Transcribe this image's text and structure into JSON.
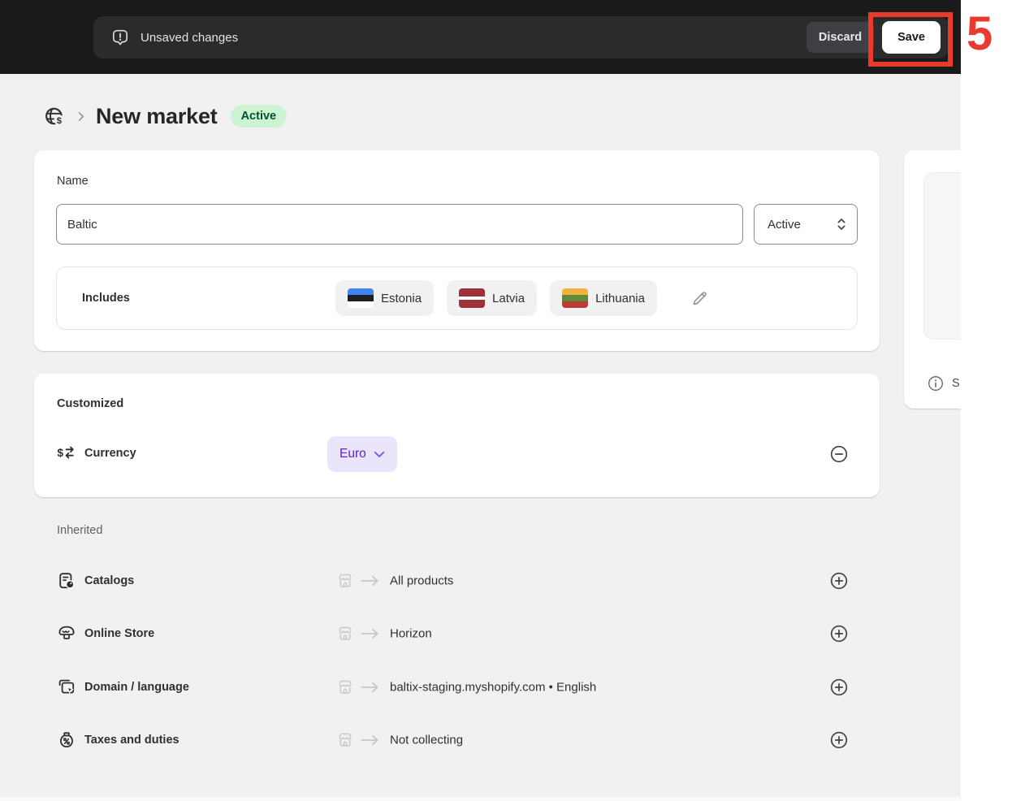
{
  "topbar": {
    "message": "Unsaved changes",
    "discard_label": "Discard",
    "save_label": "Save",
    "icons": {
      "status": "alert-bubble-icon"
    }
  },
  "annotation": {
    "number": "5",
    "color": "#e93a2d"
  },
  "header": {
    "title": "New market",
    "status_badge": "Active",
    "badge_bg": "#ccf4d2",
    "badge_text_color": "#07502f",
    "icons": {
      "breadcrumb": "markets-globe-dollar-icon",
      "separator": "chevron-right-icon"
    }
  },
  "market_card": {
    "name_label": "Name",
    "name_value": "Baltic",
    "status_value": "Active",
    "includes_label": "Includes",
    "countries": [
      {
        "name": "Estonia",
        "flag": {
          "stripes": [
            {
              "color": "#4285f4",
              "grow": "1"
            },
            {
              "color": "#1f1f1f",
              "grow": "1"
            },
            {
              "color": "#ffffff",
              "grow": "1"
            }
          ]
        }
      },
      {
        "name": "Latvia",
        "flag": {
          "stripes": [
            {
              "color": "#9e3039",
              "grow": "2"
            },
            {
              "color": "#ffffff",
              "grow": "1"
            },
            {
              "color": "#9e3039",
              "grow": "2"
            }
          ]
        }
      },
      {
        "name": "Lithuania",
        "flag": {
          "stripes": [
            {
              "color": "#f2b23e",
              "grow": "1"
            },
            {
              "color": "#5c8b3c",
              "grow": "1"
            },
            {
              "color": "#be3a34",
              "grow": "1"
            }
          ]
        }
      }
    ],
    "icons": {
      "edit": "pencil-icon",
      "status_select": "updown-chevrons-icon"
    }
  },
  "customized_card": {
    "title": "Customized",
    "currency_label": "Currency",
    "currency_value": "Euro",
    "chip_bg": "#ebe5fc",
    "chip_text_color": "#5e1ee0",
    "icons": {
      "row": "currency-exchange-icon",
      "remove": "minus-circle-icon",
      "chip": "chevron-down-icon"
    }
  },
  "inherited": {
    "title": "Inherited",
    "rows": [
      {
        "label": "Catalogs",
        "value": "All products",
        "icon": "catalogs-icon"
      },
      {
        "label": "Online Store",
        "value": "Horizon",
        "icon": "storefront-icon"
      },
      {
        "label": "Domain / language",
        "value": "baltix-staging.myshopify.com • English",
        "icon": "domain-language-icon"
      },
      {
        "label": "Taxes and duties",
        "value": "Not collecting",
        "icon": "taxes-duties-icon"
      }
    ],
    "shared_icons": {
      "source": "store-icon",
      "arrow": "arrow-right-icon",
      "add": "plus-circle-icon"
    }
  },
  "side_panel": {
    "info_text": "S",
    "icons": {
      "info": "info-circle-icon"
    }
  }
}
